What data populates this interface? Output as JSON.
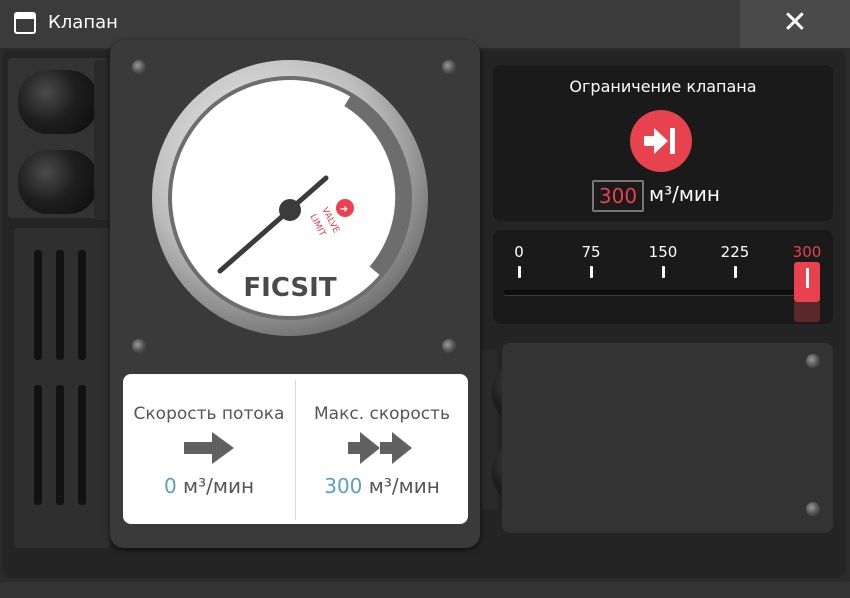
{
  "window": {
    "title": "Клапан",
    "close_label": "✕"
  },
  "gauge": {
    "logo": "FICSIT",
    "badge_line1": "VALVE",
    "badge_line2": "LIMIT",
    "needle_level": 0.8
  },
  "flow": {
    "current_label": "Скорость потока",
    "current_value": "0",
    "max_label": "Макс. скорость",
    "max_value": "300",
    "unit": "м³/мин"
  },
  "limit": {
    "title": "Ограничение клапана",
    "value": "300",
    "unit": "м³/мин",
    "accent_color": "#e8424e"
  },
  "slider": {
    "ticks": [
      "0",
      "75",
      "150",
      "225",
      "300"
    ],
    "value": 300,
    "max": 300
  },
  "icons": {
    "window": "window-icon",
    "close": "close-icon",
    "limit": "valve-limit-icon",
    "flow": "arrow-right-icon",
    "max": "double-arrow-right-icon"
  }
}
